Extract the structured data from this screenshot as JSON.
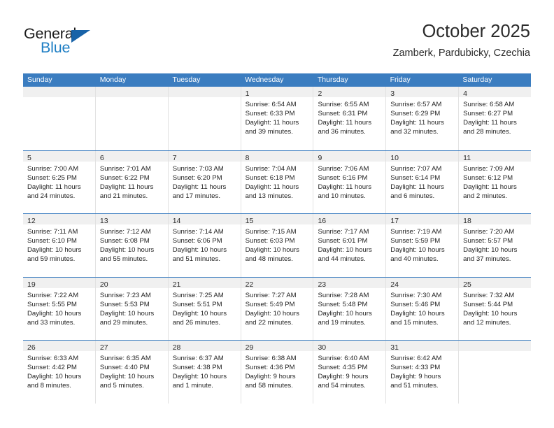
{
  "brand": {
    "name_top": "General",
    "name_bottom": "Blue",
    "accent_color": "#1863a8",
    "blue_text_color": "#1f7fc4"
  },
  "header": {
    "title": "October 2025",
    "subtitle": "Zamberk, Pardubicky, Czechia"
  },
  "theme": {
    "header_band": "#3b7dc0",
    "cell_head_bg": "#f0f0f0",
    "grid_line": "#e2e2e2",
    "text": "#242424"
  },
  "weekdays": [
    "Sunday",
    "Monday",
    "Tuesday",
    "Wednesday",
    "Thursday",
    "Friday",
    "Saturday"
  ],
  "weeks": [
    [
      {
        "day": "",
        "empty": true
      },
      {
        "day": "",
        "empty": true
      },
      {
        "day": "",
        "empty": true
      },
      {
        "day": "1",
        "sunrise": "Sunrise: 6:54 AM",
        "sunset": "Sunset: 6:33 PM",
        "daylight1": "Daylight: 11 hours",
        "daylight2": "and 39 minutes."
      },
      {
        "day": "2",
        "sunrise": "Sunrise: 6:55 AM",
        "sunset": "Sunset: 6:31 PM",
        "daylight1": "Daylight: 11 hours",
        "daylight2": "and 36 minutes."
      },
      {
        "day": "3",
        "sunrise": "Sunrise: 6:57 AM",
        "sunset": "Sunset: 6:29 PM",
        "daylight1": "Daylight: 11 hours",
        "daylight2": "and 32 minutes."
      },
      {
        "day": "4",
        "sunrise": "Sunrise: 6:58 AM",
        "sunset": "Sunset: 6:27 PM",
        "daylight1": "Daylight: 11 hours",
        "daylight2": "and 28 minutes."
      }
    ],
    [
      {
        "day": "5",
        "sunrise": "Sunrise: 7:00 AM",
        "sunset": "Sunset: 6:25 PM",
        "daylight1": "Daylight: 11 hours",
        "daylight2": "and 24 minutes."
      },
      {
        "day": "6",
        "sunrise": "Sunrise: 7:01 AM",
        "sunset": "Sunset: 6:22 PM",
        "daylight1": "Daylight: 11 hours",
        "daylight2": "and 21 minutes."
      },
      {
        "day": "7",
        "sunrise": "Sunrise: 7:03 AM",
        "sunset": "Sunset: 6:20 PM",
        "daylight1": "Daylight: 11 hours",
        "daylight2": "and 17 minutes."
      },
      {
        "day": "8",
        "sunrise": "Sunrise: 7:04 AM",
        "sunset": "Sunset: 6:18 PM",
        "daylight1": "Daylight: 11 hours",
        "daylight2": "and 13 minutes."
      },
      {
        "day": "9",
        "sunrise": "Sunrise: 7:06 AM",
        "sunset": "Sunset: 6:16 PM",
        "daylight1": "Daylight: 11 hours",
        "daylight2": "and 10 minutes."
      },
      {
        "day": "10",
        "sunrise": "Sunrise: 7:07 AM",
        "sunset": "Sunset: 6:14 PM",
        "daylight1": "Daylight: 11 hours",
        "daylight2": "and 6 minutes."
      },
      {
        "day": "11",
        "sunrise": "Sunrise: 7:09 AM",
        "sunset": "Sunset: 6:12 PM",
        "daylight1": "Daylight: 11 hours",
        "daylight2": "and 2 minutes."
      }
    ],
    [
      {
        "day": "12",
        "sunrise": "Sunrise: 7:11 AM",
        "sunset": "Sunset: 6:10 PM",
        "daylight1": "Daylight: 10 hours",
        "daylight2": "and 59 minutes."
      },
      {
        "day": "13",
        "sunrise": "Sunrise: 7:12 AM",
        "sunset": "Sunset: 6:08 PM",
        "daylight1": "Daylight: 10 hours",
        "daylight2": "and 55 minutes."
      },
      {
        "day": "14",
        "sunrise": "Sunrise: 7:14 AM",
        "sunset": "Sunset: 6:06 PM",
        "daylight1": "Daylight: 10 hours",
        "daylight2": "and 51 minutes."
      },
      {
        "day": "15",
        "sunrise": "Sunrise: 7:15 AM",
        "sunset": "Sunset: 6:03 PM",
        "daylight1": "Daylight: 10 hours",
        "daylight2": "and 48 minutes."
      },
      {
        "day": "16",
        "sunrise": "Sunrise: 7:17 AM",
        "sunset": "Sunset: 6:01 PM",
        "daylight1": "Daylight: 10 hours",
        "daylight2": "and 44 minutes."
      },
      {
        "day": "17",
        "sunrise": "Sunrise: 7:19 AM",
        "sunset": "Sunset: 5:59 PM",
        "daylight1": "Daylight: 10 hours",
        "daylight2": "and 40 minutes."
      },
      {
        "day": "18",
        "sunrise": "Sunrise: 7:20 AM",
        "sunset": "Sunset: 5:57 PM",
        "daylight1": "Daylight: 10 hours",
        "daylight2": "and 37 minutes."
      }
    ],
    [
      {
        "day": "19",
        "sunrise": "Sunrise: 7:22 AM",
        "sunset": "Sunset: 5:55 PM",
        "daylight1": "Daylight: 10 hours",
        "daylight2": "and 33 minutes."
      },
      {
        "day": "20",
        "sunrise": "Sunrise: 7:23 AM",
        "sunset": "Sunset: 5:53 PM",
        "daylight1": "Daylight: 10 hours",
        "daylight2": "and 29 minutes."
      },
      {
        "day": "21",
        "sunrise": "Sunrise: 7:25 AM",
        "sunset": "Sunset: 5:51 PM",
        "daylight1": "Daylight: 10 hours",
        "daylight2": "and 26 minutes."
      },
      {
        "day": "22",
        "sunrise": "Sunrise: 7:27 AM",
        "sunset": "Sunset: 5:49 PM",
        "daylight1": "Daylight: 10 hours",
        "daylight2": "and 22 minutes."
      },
      {
        "day": "23",
        "sunrise": "Sunrise: 7:28 AM",
        "sunset": "Sunset: 5:48 PM",
        "daylight1": "Daylight: 10 hours",
        "daylight2": "and 19 minutes."
      },
      {
        "day": "24",
        "sunrise": "Sunrise: 7:30 AM",
        "sunset": "Sunset: 5:46 PM",
        "daylight1": "Daylight: 10 hours",
        "daylight2": "and 15 minutes."
      },
      {
        "day": "25",
        "sunrise": "Sunrise: 7:32 AM",
        "sunset": "Sunset: 5:44 PM",
        "daylight1": "Daylight: 10 hours",
        "daylight2": "and 12 minutes."
      }
    ],
    [
      {
        "day": "26",
        "sunrise": "Sunrise: 6:33 AM",
        "sunset": "Sunset: 4:42 PM",
        "daylight1": "Daylight: 10 hours",
        "daylight2": "and 8 minutes."
      },
      {
        "day": "27",
        "sunrise": "Sunrise: 6:35 AM",
        "sunset": "Sunset: 4:40 PM",
        "daylight1": "Daylight: 10 hours",
        "daylight2": "and 5 minutes."
      },
      {
        "day": "28",
        "sunrise": "Sunrise: 6:37 AM",
        "sunset": "Sunset: 4:38 PM",
        "daylight1": "Daylight: 10 hours",
        "daylight2": "and 1 minute."
      },
      {
        "day": "29",
        "sunrise": "Sunrise: 6:38 AM",
        "sunset": "Sunset: 4:36 PM",
        "daylight1": "Daylight: 9 hours",
        "daylight2": "and 58 minutes."
      },
      {
        "day": "30",
        "sunrise": "Sunrise: 6:40 AM",
        "sunset": "Sunset: 4:35 PM",
        "daylight1": "Daylight: 9 hours",
        "daylight2": "and 54 minutes."
      },
      {
        "day": "31",
        "sunrise": "Sunrise: 6:42 AM",
        "sunset": "Sunset: 4:33 PM",
        "daylight1": "Daylight: 9 hours",
        "daylight2": "and 51 minutes."
      },
      {
        "day": "",
        "empty": true
      }
    ]
  ]
}
